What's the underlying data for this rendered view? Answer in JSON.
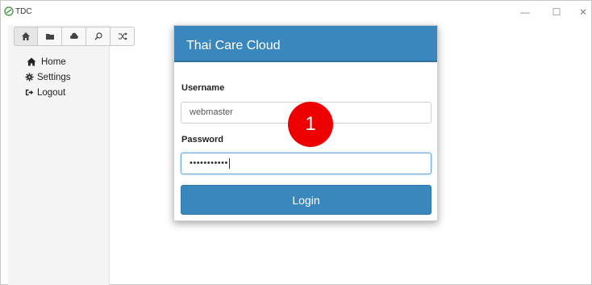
{
  "window": {
    "title": "TDC",
    "controls": {
      "minimize": "—",
      "maximize": "☐",
      "close": "✕"
    }
  },
  "toolbar": {
    "buttons": [
      {
        "icon": "home-icon"
      },
      {
        "icon": "folder-icon"
      },
      {
        "icon": "cloud-icon"
      },
      {
        "icon": "search-icon"
      },
      {
        "icon": "shuffle-icon"
      }
    ]
  },
  "sidebar": {
    "items": [
      {
        "label": "Home",
        "icon": "home-icon"
      },
      {
        "label": "Settings",
        "icon": "gear-icon"
      },
      {
        "label": "Logout",
        "icon": "sign-out-icon"
      }
    ]
  },
  "login": {
    "title": "Thai Care Cloud",
    "username_label": "Username",
    "username_value": "webmaster",
    "password_label": "Password",
    "password_value": "•••••••••••",
    "button_label": "Login"
  },
  "annotation": {
    "badge": "1"
  },
  "colors": {
    "accent": "#3a87bd",
    "badge": "#ee0000"
  }
}
